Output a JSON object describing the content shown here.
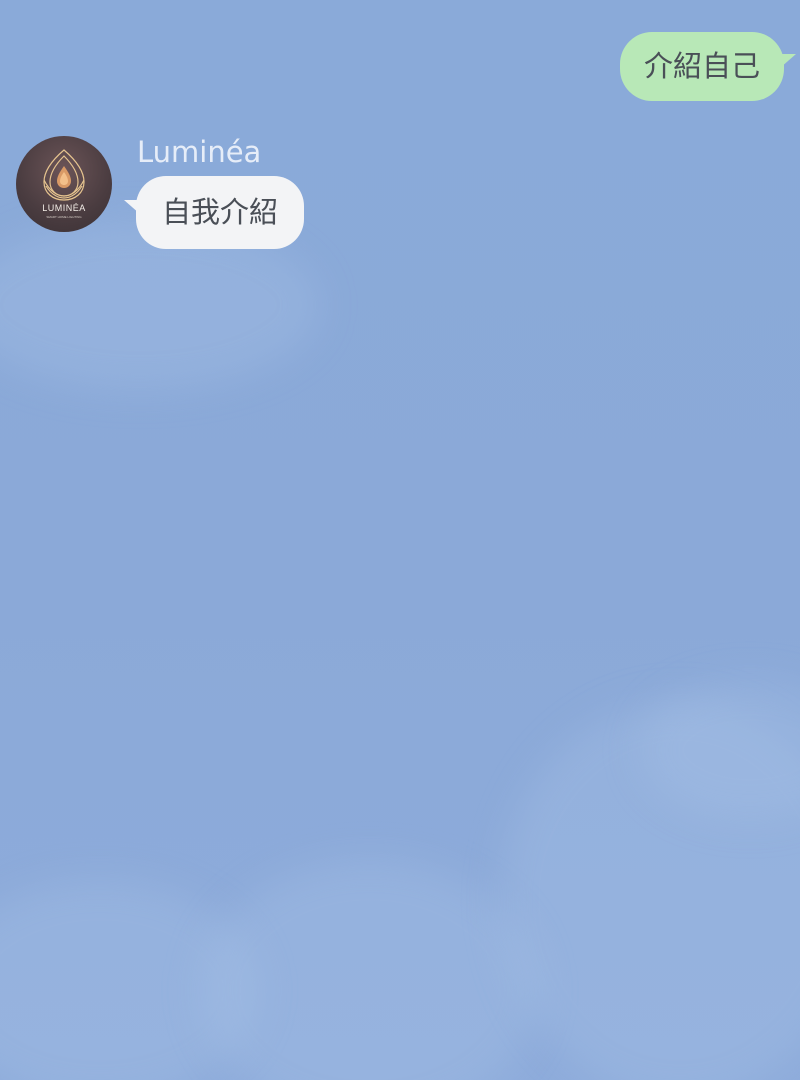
{
  "chat": {
    "outgoing": {
      "text": "介紹自己"
    },
    "incoming": {
      "sender_name": "Luminéa",
      "text": "自我介紹",
      "avatar": {
        "icon": "luminea-logo-icon",
        "logo_text": "LUMINÉA",
        "logo_subtext": "SMART HOME LIGHTING"
      }
    }
  },
  "colors": {
    "background": "#8aaad9",
    "outgoing_bubble": "#b8e8b7",
    "incoming_bubble": "#f3f4f6",
    "message_text": "#4a4f57",
    "sender_name": "#e6edf8",
    "avatar_bg": "#4a3c40",
    "logo_gold": "#e6c48f"
  }
}
